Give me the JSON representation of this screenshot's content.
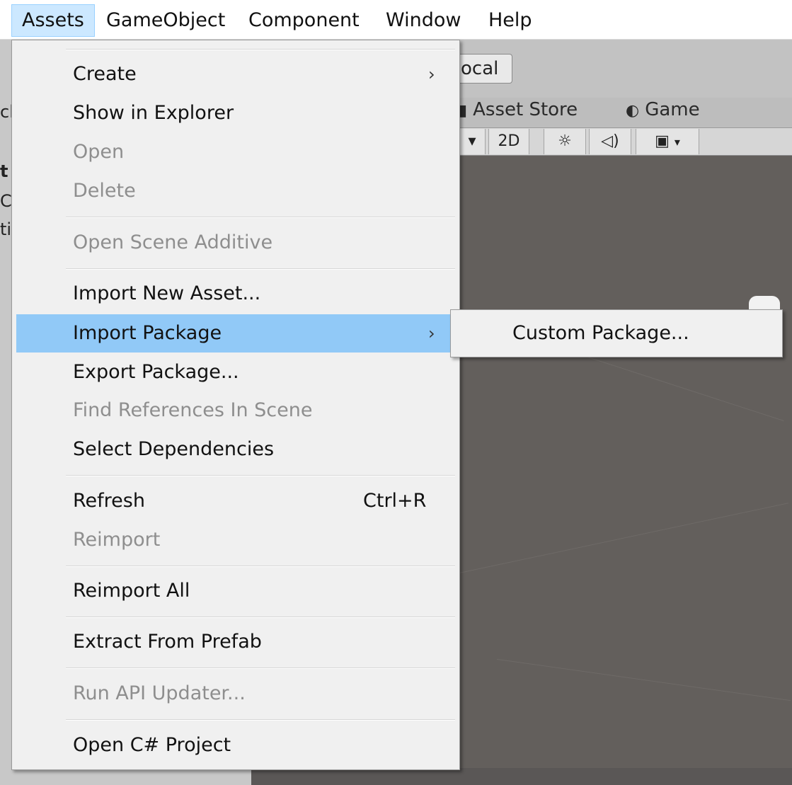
{
  "menubar": {
    "items": [
      "Assets",
      "GameObject",
      "Component",
      "Window",
      "Help"
    ]
  },
  "background": {
    "left_panel_fragments": [
      "cl",
      "t",
      "C",
      "ti"
    ],
    "local_button": "ocal",
    "tabs": {
      "asset_store": "Asset Store",
      "game": "Game"
    },
    "scene_toolbar": {
      "mode_2d": "2D",
      "sun_icon": "☼",
      "audio_icon": "🔊",
      "image_icon": "▣"
    }
  },
  "assets_menu": {
    "create": "Create",
    "show_in_explorer": "Show in Explorer",
    "open": "Open",
    "delete": "Delete",
    "open_scene_additive": "Open Scene Additive",
    "import_new_asset": "Import New Asset...",
    "import_package": "Import Package",
    "export_package": "Export Package...",
    "find_references": "Find References In Scene",
    "select_dependencies": "Select Dependencies",
    "refresh": "Refresh",
    "refresh_shortcut": "Ctrl+R",
    "reimport": "Reimport",
    "reimport_all": "Reimport All",
    "extract_from_prefab": "Extract From Prefab",
    "run_api_updater": "Run API Updater...",
    "open_csharp_project": "Open C# Project"
  },
  "submenu": {
    "custom_package": "Custom Package..."
  },
  "icons": {
    "chevron": "›"
  }
}
